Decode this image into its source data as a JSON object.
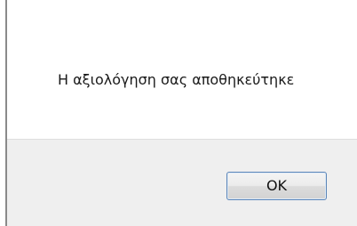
{
  "dialog": {
    "message": "Η αξιολόγηση σας αποθηκεύτηκε",
    "ok_label": "OK"
  },
  "colors": {
    "footer_background": "#efefef",
    "button_border": "#5c86b8",
    "frame": "#8a8a8a"
  }
}
